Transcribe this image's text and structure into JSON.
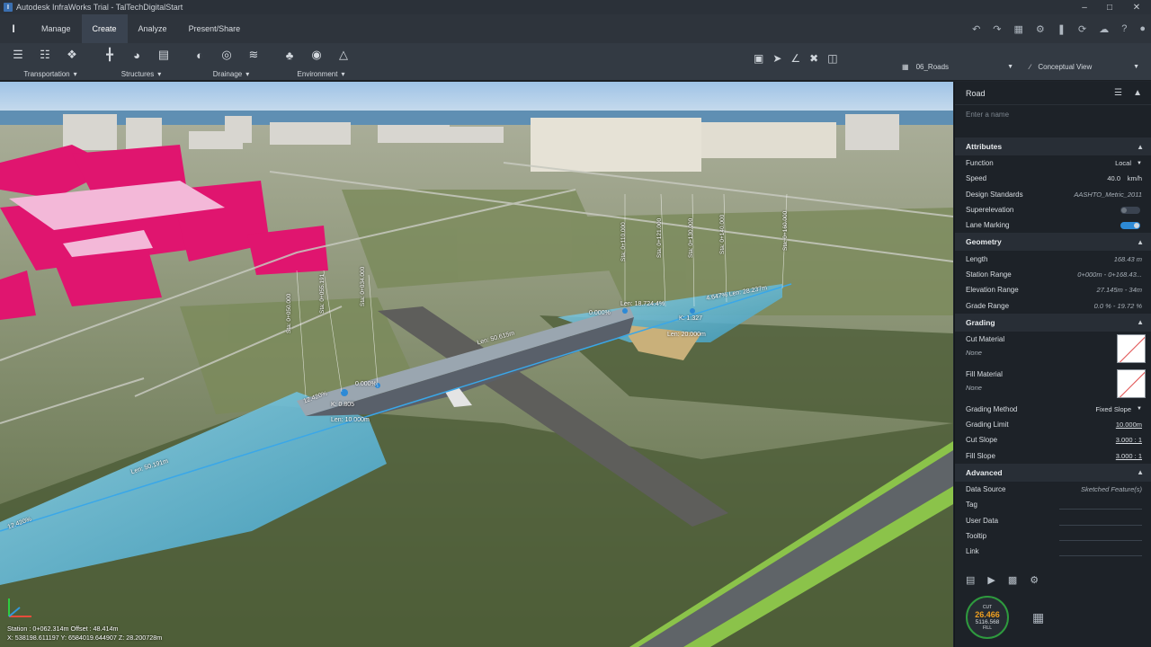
{
  "app": {
    "title": "Autodesk InfraWorks Trial - TalTechDigitalStart",
    "icon": "infraworks-app-icon"
  },
  "ribbon": {
    "logo": "I",
    "tabs": [
      {
        "label": "Manage",
        "active": false
      },
      {
        "label": "Create",
        "active": true
      },
      {
        "label": "Analyze",
        "active": false
      },
      {
        "label": "Present/Share",
        "active": false
      }
    ],
    "groups": [
      {
        "label": "Transportation",
        "icons": [
          "road-icon",
          "railway-icon",
          "intersection-icon"
        ]
      },
      {
        "label": "Structures",
        "icons": [
          "bridge-icon",
          "tunnel-icon",
          "building-icon"
        ]
      },
      {
        "label": "Drainage",
        "icons": [
          "culvert-icon",
          "pipe-icon",
          "watershed-icon"
        ]
      },
      {
        "label": "Environment",
        "icons": [
          "tree-icon",
          "water-icon",
          "terrain-icon"
        ]
      }
    ]
  },
  "view": {
    "proposal": "06_Roads",
    "visual_style": "Conceptual View"
  },
  "scene_labels": {
    "len_center": "Len: 50.615m",
    "len_left": "Len: 50.191m",
    "len_right": "Len: 20.000m",
    "len_bottom": "Len: 10.000m",
    "len_top": "Len: 18.724.4%",
    "k1": "K: 1.327",
    "k2": "K: 0.805",
    "grade_a": "4.647% Len: 28.237m",
    "grade_b": "12.420%",
    "grade_c": "12.420%",
    "pct_a": "0.000%",
    "pct_b": "0.000%",
    "stations": [
      "Sta: 0+050.000",
      "Sta: 0+055.191",
      "Sta: 0+034.000",
      "Sta: 0+110.000",
      "Sta: 0+121.000",
      "Sta: 0+130.000",
      "Sta: 0+140.000",
      "Sta: 0+160.000"
    ]
  },
  "status": {
    "line1": "Station : 0+062.314m Offset : 48.414m",
    "line2": "X: 538198.611197 Y: 6584019.644907 Z: 28.200728m"
  },
  "panel": {
    "title": "Road",
    "name_placeholder": "Enter a name",
    "attributes": {
      "header": "Attributes",
      "function_label": "Function",
      "function_value": "Local",
      "speed_label": "Speed",
      "speed_value": "40.0",
      "speed_unit": "km/h",
      "design_label": "Design Standards",
      "design_value": "AASHTO_Metric_2011",
      "super_label": "Superelevation",
      "super_on": false,
      "lane_label": "Lane Marking",
      "lane_on": true
    },
    "geometry": {
      "header": "Geometry",
      "length_label": "Length",
      "length_value": "168.43  m",
      "station_label": "Station Range",
      "station_value": "0+000m - 0+168.43...",
      "elev_label": "Elevation Range",
      "elev_value": "27.145m - 34m",
      "grade_label": "Grade Range",
      "grade_value": "0.0 % - 19.72 %"
    },
    "grading": {
      "header": "Grading",
      "cut_material_label": "Cut Material",
      "cut_material_value": "None",
      "fill_material_label": "Fill Material",
      "fill_material_value": "None",
      "method_label": "Grading Method",
      "method_value": "Fixed Slope",
      "limit_label": "Grading Limit",
      "limit_value": "10.000m",
      "cut_slope_label": "Cut Slope",
      "cut_slope_value": "3.000 : 1",
      "fill_slope_label": "Fill Slope",
      "fill_slope_value": "3.000 : 1"
    },
    "advanced": {
      "header": "Advanced",
      "source_label": "Data Source",
      "source_value": "Sketched Feature(s)",
      "tag_label": "Tag",
      "user_label": "User Data",
      "tooltip_label": "Tooltip",
      "link_label": "Link"
    },
    "gauge": {
      "cut": "26.466",
      "fill": "5116.568",
      "cut_label": "CUT",
      "fill_label": "FILL"
    }
  },
  "colors": {
    "accent": "#2d8ad6",
    "buildings": "#e0156f",
    "water": "#6fc2e0",
    "gauge_cut": "#f0a020"
  }
}
